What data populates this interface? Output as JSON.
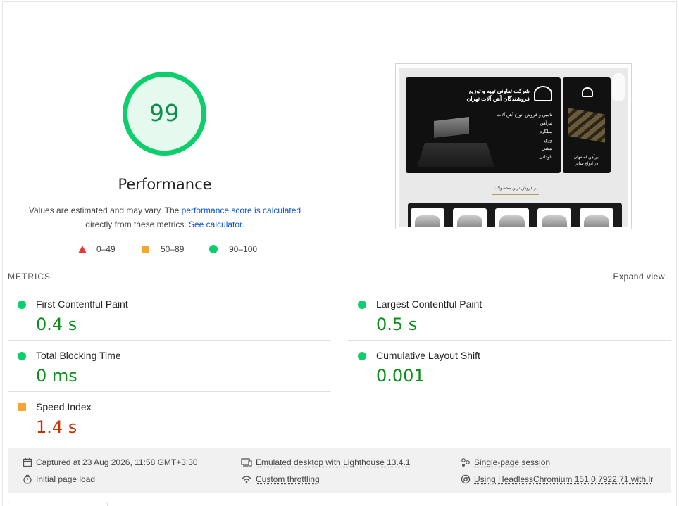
{
  "score": {
    "value": "99",
    "label": "Performance",
    "color": "#0cce6b",
    "fraction": 0.99
  },
  "description": {
    "text1": "Values are estimated and may vary. The ",
    "link1": "performance score is calculated",
    "text2": "directly from these metrics.",
    "link2": "See calculator."
  },
  "legend": [
    {
      "range": "0–49",
      "shape": "triangle",
      "color": "#e53935"
    },
    {
      "range": "50–89",
      "shape": "square",
      "color": "#f4a534"
    },
    {
      "range": "90–100",
      "shape": "circle",
      "color": "#0cce6b"
    }
  ],
  "thumbnail": {
    "headline1": "شرکت تعاونی تهیه و توزیع",
    "headline2": "فروشندگان آهن آلات تهران",
    "subline": "تامین و فروش انواع آهن آلات",
    "items": [
      "تیرآهن",
      "میلگرد",
      "ورق",
      "نبشی",
      "ناودانی"
    ],
    "side_caption1": "تیرآهن اصفهان",
    "side_caption2": "در انواع سایز",
    "section_title": "پر فروش ترین محصولات"
  },
  "metrics": {
    "title": "METRICS",
    "expand_label": "Expand view",
    "items": [
      {
        "label": "First Contentful Paint",
        "value": "0.4 s",
        "status": "good"
      },
      {
        "label": "Largest Contentful Paint",
        "value": "0.5 s",
        "status": "good"
      },
      {
        "label": "Total Blocking Time",
        "value": "0 ms",
        "status": "good"
      },
      {
        "label": "Cumulative Layout Shift",
        "value": "0.001",
        "status": "good"
      },
      {
        "label": "Speed Index",
        "value": "1.4 s",
        "status": "average"
      }
    ]
  },
  "footer": {
    "captured": "Captured at 23 Aug 2026, 11:58 GMT+3:30",
    "page_load": "Initial page load",
    "emulated": "Emulated desktop with Lighthouse 13.4.1",
    "throttling": "Custom throttling",
    "session": "Single-page session",
    "browser": "Using HeadlessChromium 151.0.7922.71 with lr"
  }
}
